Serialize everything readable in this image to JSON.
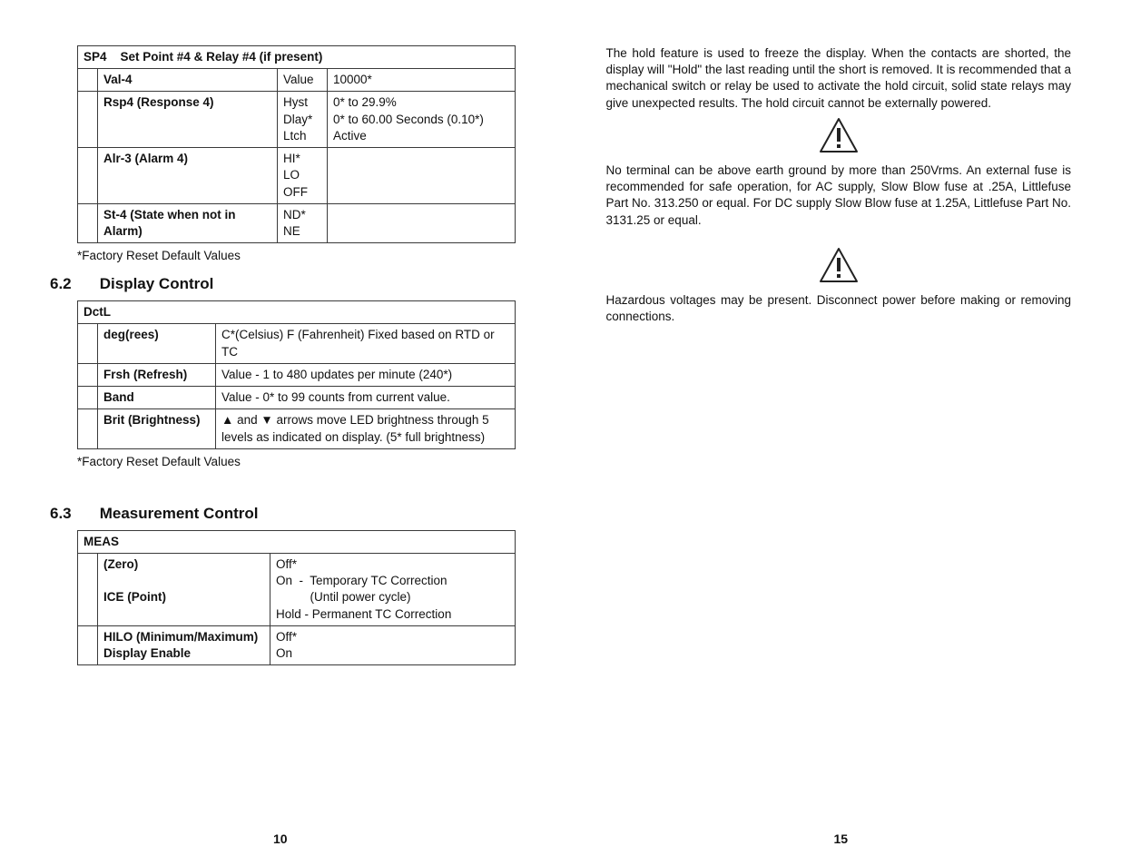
{
  "left": {
    "sp4": {
      "header_code": "SP4",
      "header_title": "Set Point #4 & Relay #4 (if present)",
      "r1": {
        "label": "Val-4",
        "mid": "Value",
        "val": "10000*"
      },
      "r2": {
        "label": "Rsp4 (Response 4)",
        "mid": "Hyst\nDlay*\nLtch",
        "val": "0* to 29.9%\n0* to 60.00 Seconds (0.10*)\nActive"
      },
      "r3": {
        "label": "Alr-3 (Alarm 4)",
        "mid": "HI*\nLO\nOFF",
        "val": ""
      },
      "r4": {
        "label": "St-4 (State when not in Alarm)",
        "mid": "ND*\nNE",
        "val": ""
      }
    },
    "note1": "*Factory Reset Default Values",
    "sec62_num": "6.2",
    "sec62_title": "Display Control",
    "dctl": {
      "header": "DctL",
      "r1": {
        "label": "deg(rees)",
        "val": "C*(Celsius)  F (Fahrenheit) Fixed based on RTD or TC"
      },
      "r2": {
        "label": "Frsh (Refresh)",
        "val": "Value - 1 to 480 updates per minute (240*)"
      },
      "r3": {
        "label": "Band",
        "val": "Value - 0* to 99 counts from current value."
      },
      "r4": {
        "label": "Brit (Brightness)",
        "val": "▲ and ▼ arrows move LED brightness through 5 levels as indicated on display. (5* full brightness)"
      }
    },
    "note2": "*Factory Reset Default Values",
    "sec63_num": "6.3",
    "sec63_title": "Measurement Control",
    "meas": {
      "header": "MEAS",
      "r1": {
        "label1": "(Zero)",
        "label2": "ICE (Point)",
        "val": "Off*\nOn  -  Temporary TC Correction\n          (Until power cycle)\nHold - Permanent TC Correction"
      },
      "r2": {
        "label": "HILO (Minimum/Maximum) Display Enable",
        "val": "Off*\nOn"
      }
    },
    "page_num": "10"
  },
  "right": {
    "para1": " The hold feature is used to freeze the display. When the contacts are shorted, the display will \"Hold\" the last reading until the short is removed. It is recommended that a mechanical switch or relay be used to activate the hold circuit, solid state relays may give unexpected results. The hold circuit cannot be externally powered.",
    "para2": "No terminal can be  above earth ground by more than 250Vrms. An external fuse is recommended for safe operation, for AC supply, Slow Blow fuse at .25A, Littlefuse Part No. 313.250 or equal. For DC supply Slow Blow fuse at 1.25A, Littlefuse Part No. 3131.25 or equal.",
    "para3": "Hazardous voltages may be present. Disconnect power before making or removing connections.",
    "page_num": "15"
  }
}
